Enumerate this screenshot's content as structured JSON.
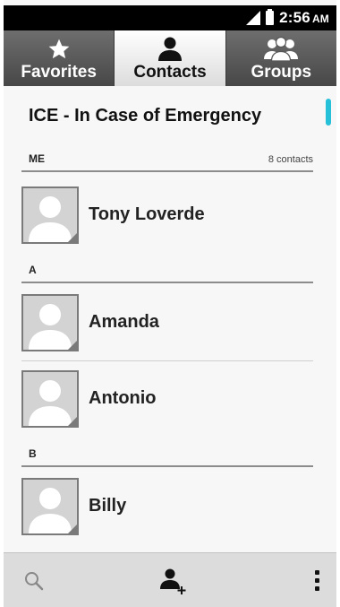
{
  "status_bar": {
    "time": "2:56",
    "ampm": "AM"
  },
  "tabs": [
    {
      "label": "Favorites",
      "icon": "star-icon",
      "active": false
    },
    {
      "label": "Contacts",
      "icon": "person-icon",
      "active": true
    },
    {
      "label": "Groups",
      "icon": "group-icon",
      "active": false
    }
  ],
  "list": {
    "ice_title": "ICE - In Case of Emergency",
    "sections": [
      {
        "label": "ME",
        "count": "8 contacts"
      },
      {
        "label": "A"
      },
      {
        "label": "B"
      }
    ],
    "contacts": [
      {
        "name": "Tony Loverde"
      },
      {
        "name": "Amanda"
      },
      {
        "name": "Antonio"
      },
      {
        "name": "Billy"
      }
    ]
  },
  "bottom_bar": {
    "icons": [
      "search-icon",
      "add-contact-icon",
      "overflow-menu-icon"
    ]
  },
  "colors": {
    "accent": "#27c0d9",
    "tab_inactive": "#555555",
    "status_bar": "#000000"
  }
}
